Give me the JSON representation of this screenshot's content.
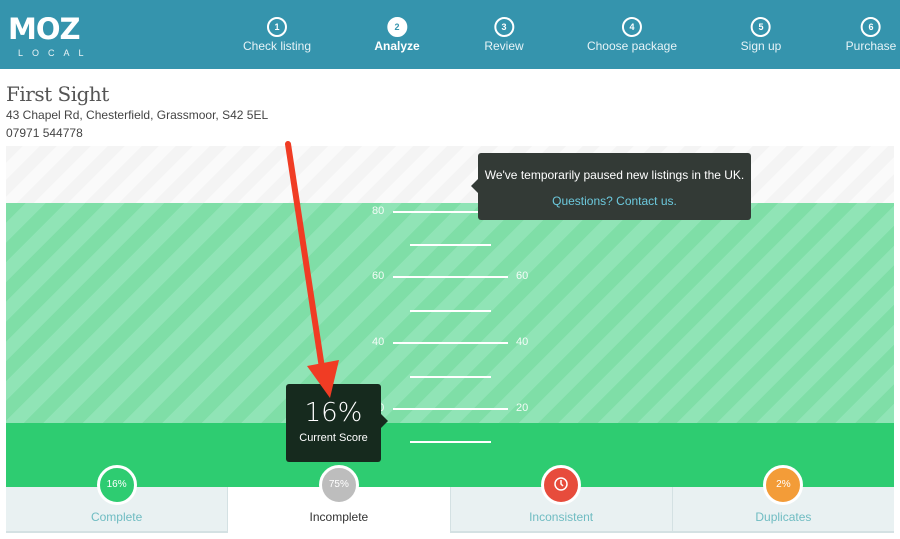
{
  "header": {
    "logo_main": "MOZ",
    "logo_sub": "LOCAL",
    "steps": [
      {
        "num": "1",
        "label": "Check listing"
      },
      {
        "num": "2",
        "label": "Analyze"
      },
      {
        "num": "3",
        "label": "Review"
      },
      {
        "num": "4",
        "label": "Choose package"
      },
      {
        "num": "5",
        "label": "Sign up"
      },
      {
        "num": "6",
        "label": "Purchase"
      }
    ],
    "active_step": 2
  },
  "business": {
    "name": "First Sight",
    "address": "43 Chapel Rd, Chesterfield, Grassmoor, S42 5EL",
    "phone": "07971 544778"
  },
  "scale": {
    "ticks": [
      "80",
      "60",
      "40",
      "20"
    ]
  },
  "notice": {
    "message": "We've temporarily paused new listings in the UK.",
    "link": "Questions? Contact us."
  },
  "score": {
    "value": "16%",
    "label": "Current Score",
    "fraction": 0.16
  },
  "tabs": [
    {
      "label": "Complete",
      "badge": "16%",
      "color": "#2ecc71"
    },
    {
      "label": "Incomplete",
      "badge": "75%",
      "color": "#bdbdbd"
    },
    {
      "label": "Inconsistent",
      "badge": "",
      "icon": "alert-clock-icon",
      "color": "#e74c3c"
    },
    {
      "label": "Duplicates",
      "badge": "2%",
      "color": "#f39c38"
    }
  ],
  "colors": {
    "header": "#3594ad",
    "green": "#2ecc71",
    "arrow": "#f03c24"
  }
}
